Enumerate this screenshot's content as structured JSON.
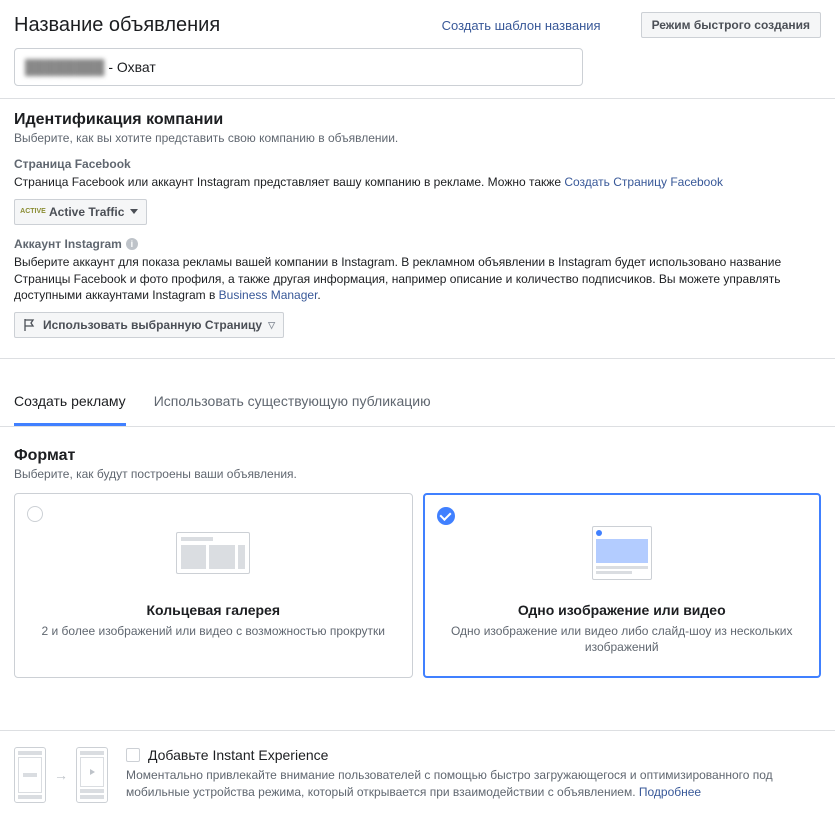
{
  "header": {
    "title": "Название объявления",
    "template_link": "Создать шаблон названия",
    "mode_button": "Режим быстрого создания",
    "ad_name_value": "- Охват"
  },
  "identity": {
    "heading": "Идентификация компании",
    "description": "Выберите, как вы хотите представить свою компанию в объявлении.",
    "fb_page_label": "Страница Facebook",
    "fb_page_desc": "Страница Facebook или аккаунт Instagram представляет вашу компанию в рекламе. Можно также ",
    "fb_page_link": "Создать Страницу Facebook",
    "fb_page_selected": "Active Traffic",
    "ig_label": "Аккаунт Instagram",
    "ig_desc_1": "Выберите аккаунт для показа рекламы вашей компании в Instagram. В рекламном объявлении в Instagram будет использовано название Страницы Facebook и фото профиля, а также другая информация, например описание и количество подписчиков. Вы можете управлять доступными аккаунтами Instagram в ",
    "ig_link": "Business Manager",
    "ig_desc_2": ".",
    "ig_selected": "Использовать выбранную Страницу"
  },
  "tabs": {
    "create": "Создать рекламу",
    "existing": "Использовать существующую публикацию"
  },
  "format": {
    "heading": "Формат",
    "description": "Выберите, как будут построены ваши объявления.",
    "carousel_title": "Кольцевая галерея",
    "carousel_desc": "2 и более изображений или видео с возможностью прокрутки",
    "single_title": "Одно изображение или видео",
    "single_desc": "Одно изображение или видео либо слайд-шоу из нескольких изображений"
  },
  "instant": {
    "title": "Добавьте Instant Experience",
    "desc": "Моментально привлекайте внимание пользователей с помощью быстро загружающегося и оптимизированного под мобильные устройства режима, который открывается при взаимодействии с объявлением. ",
    "more_link": "Подробнее"
  }
}
